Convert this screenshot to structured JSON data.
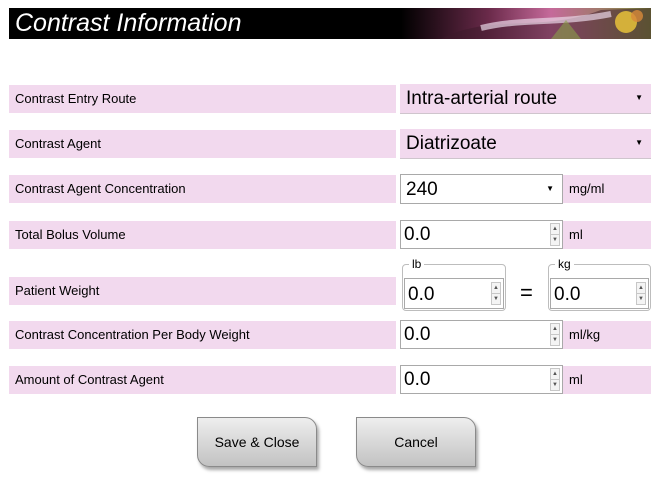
{
  "header": {
    "title": "Contrast Information"
  },
  "colors": {
    "label_bg": "#f2d9ee",
    "header_bg": "#000000"
  },
  "fields": {
    "entry_route": {
      "label": "Contrast Entry Route",
      "value": "Intra-arterial route"
    },
    "agent": {
      "label": "Contrast Agent",
      "value": "Diatrizoate"
    },
    "concentration": {
      "label": "Contrast Agent Concentration",
      "value": "240",
      "unit": "mg/ml"
    },
    "bolus_volume": {
      "label": "Total Bolus Volume",
      "value": "0.0",
      "unit": "ml"
    },
    "patient_weight": {
      "label": "Patient Weight",
      "lb_legend": "lb",
      "lb_value": "0.0",
      "equals": "=",
      "kg_legend": "kg",
      "kg_value": "0.0"
    },
    "concentration_per_weight": {
      "label": "Contrast Concentration Per Body Weight",
      "value": "0.0",
      "unit": "ml/kg"
    },
    "amount": {
      "label": "Amount of Contrast Agent",
      "value": "0.0",
      "unit": "ml"
    }
  },
  "buttons": {
    "save": "Save & Close",
    "cancel": "Cancel"
  }
}
